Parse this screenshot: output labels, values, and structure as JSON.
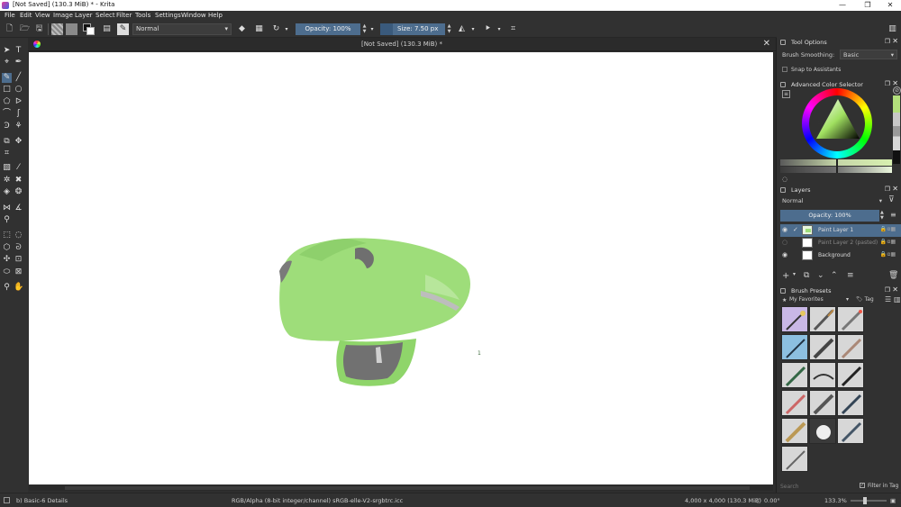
{
  "window": {
    "title": "[Not Saved]  (130.3 MiB) * - Krita"
  },
  "menu": [
    "File",
    "Edit",
    "View",
    "Image",
    "Layer",
    "Select",
    "Filter",
    "Tools",
    "Settings",
    "Window",
    "Help"
  ],
  "toolbar": {
    "blend_mode": "Normal",
    "opacity_label": "Opacity: 100%",
    "size_label": "Size: 7.50 px"
  },
  "document": {
    "tab_title": "[Not Saved]  (130.3 MiB) *",
    "annotation_mark": "1"
  },
  "tool_options": {
    "title": "Tool Options",
    "brush_smoothing_label": "Brush Smoothing:",
    "brush_smoothing_value": "Basic",
    "snap_label": "Snap to Assistants"
  },
  "color_selector": {
    "title": "Advanced Color Selector"
  },
  "layers": {
    "title": "Layers",
    "blend_mode": "Normal",
    "opacity_label": "Opacity:  100%",
    "items": [
      {
        "name": "Paint Layer 1",
        "selected": true
      },
      {
        "name": "Paint Layer 2 (pasted)",
        "selected": false
      },
      {
        "name": "Background",
        "selected": false
      }
    ]
  },
  "brush_presets": {
    "title": "Brush Presets",
    "tag_filter": "My Favorites",
    "tag_label": "Tag",
    "search_placeholder": "Search",
    "filter_in_tag_label": "Filter in Tag"
  },
  "status": {
    "brush": "b) Basic-6 Details",
    "color_space": "RGB/Alpha (8-bit integer/channel)  sRGB-elle-V2-srgbtrc.icc",
    "dimensions": "4,000 x 4,000 (130.3 MiB)",
    "rotation": "0.00°",
    "zoom": "133.3%"
  },
  "colors": {
    "accent": "#4d6d8e",
    "paint_green": "#9cdc78",
    "paint_gray": "#707070"
  }
}
